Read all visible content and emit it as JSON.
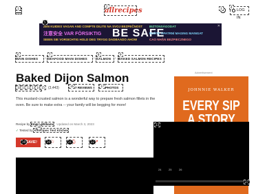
{
  "markers": [
    "1",
    "2",
    "3",
    "4",
    "5",
    "6",
    "7",
    "8",
    "9",
    "10",
    "11",
    "12",
    "13",
    "14",
    "15",
    "16",
    "17",
    "18",
    "19",
    "20",
    "21",
    "22",
    "23",
    "24",
    "25",
    "26",
    "27"
  ],
  "header": {
    "logo": "allrecipes",
    "login_label": "LOG IN"
  },
  "banner": {
    "row1": "ZEN KUIDES  VAGAN AND COMPTE  DILITE NA SVOJ BEZPEČNOST",
    "row1b": "BIZTONSÁGODAT",
    "row2": "注意安全 VAR FÖRSIKTIG",
    "safe": "BE SAFE",
    "row3": "SEIEN SIE VORSICHTIG  HOLD DEG TRYGG  DADBAADO AHOW",
    "row3b": "BUĎTE OPATRNÍ  MAGING MAINGAT",
    "row3c": "CAO NHẬN  BEZPIECZNEGO",
    "close": "✕"
  },
  "breadcrumb": [
    "MAIN DISHES",
    "SEAFOOD MAIN DISHES",
    "SALMON",
    "BAKED SALMON RECIPES"
  ],
  "recipe": {
    "title": "Baked Dijon Salmon",
    "stars": "★★★★★",
    "rating_count": "(3,443)",
    "reviews_link": "2,347 REVIEWS",
    "photos_link": "451 PHOTOS",
    "description": "This mustard-crusted salmon is a wonderful way to prepare fresh salmon fillets in the oven. Be sure to make extra -- your family will be begging for more!",
    "recipe_by": "Recipe by ",
    "author": "Emma Williams",
    "updated": "Updated on March 3, 2023",
    "tested_prefix": "Tested by ",
    "tested_link": "Allrecipes Test Kitchen"
  },
  "actions": {
    "save_label": "SAVE"
  },
  "side_ad": {
    "label": "Advertisement",
    "brand": "JOHNNIE WALKER",
    "line1": "EVERY SIP",
    "line2": "A STORY"
  },
  "video": {
    "nums": [
      "24",
      "25",
      "26"
    ]
  },
  "colors": {
    "brand_red": "#d4382b",
    "ad_orange": "#e06a1e",
    "banner_bg": "#1b1534"
  }
}
